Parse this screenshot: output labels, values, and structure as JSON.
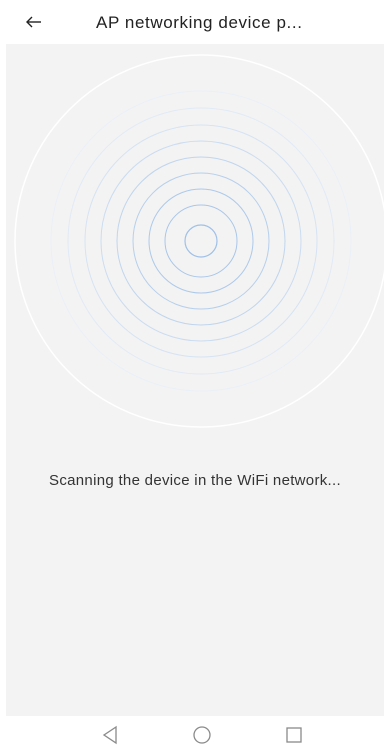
{
  "header": {
    "back_icon": "arrow-left-icon",
    "title": "AP networking device p..."
  },
  "main": {
    "radar_icon": "radar-pulse-icon",
    "status_text": "Scanning the device in the WiFi network..."
  },
  "navbar": {
    "back_icon": "triangle-back-icon",
    "home_icon": "circle-home-icon",
    "recents_icon": "square-recents-icon"
  },
  "colors": {
    "content_background": "#f3f3f3",
    "ring_color": "#a9c6ea"
  }
}
